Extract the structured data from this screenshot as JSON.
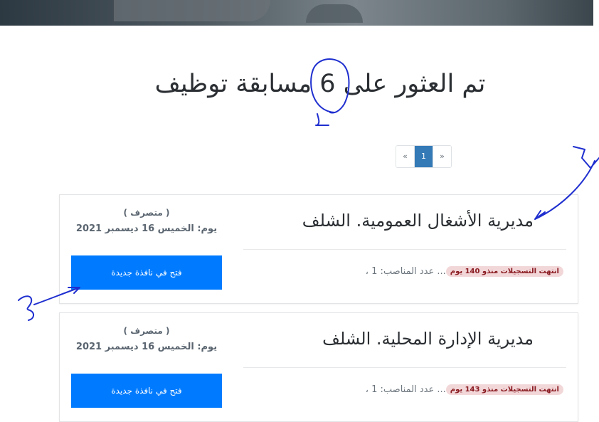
{
  "headline": "تم العثور على 6 مسابقة توظيف",
  "pagination": {
    "prev": "«",
    "current": "1",
    "next": "»"
  },
  "cards": [
    {
      "title": "مديرية الأشغال العمومية. الشلف",
      "status": "( متصرف )",
      "date": "يوم: الخميس 16 ديسمبر 2021",
      "button": "فتح في نافذة جديدة",
      "positions": "... عدد المناصب: 1 ،",
      "badge": "انتهت التسجيلات منذو 140 يوم"
    },
    {
      "title": "مديرية الإدارة المحلية. الشلف",
      "status": "( متصرف )",
      "date": "يوم: الخميس 16 ديسمبر 2021",
      "button": "فتح في نافذة جديدة",
      "positions": "... عدد المناصب: 1 ،",
      "badge": "انتهت التسجيلات منذو 143 يوم"
    }
  ],
  "colors": {
    "primary_button": "#007bff",
    "pager_active": "#337ab7",
    "badge_bg": "#f2d7d9",
    "badge_text": "#8a1c22",
    "annotation_ink": "#1f2fcf"
  }
}
